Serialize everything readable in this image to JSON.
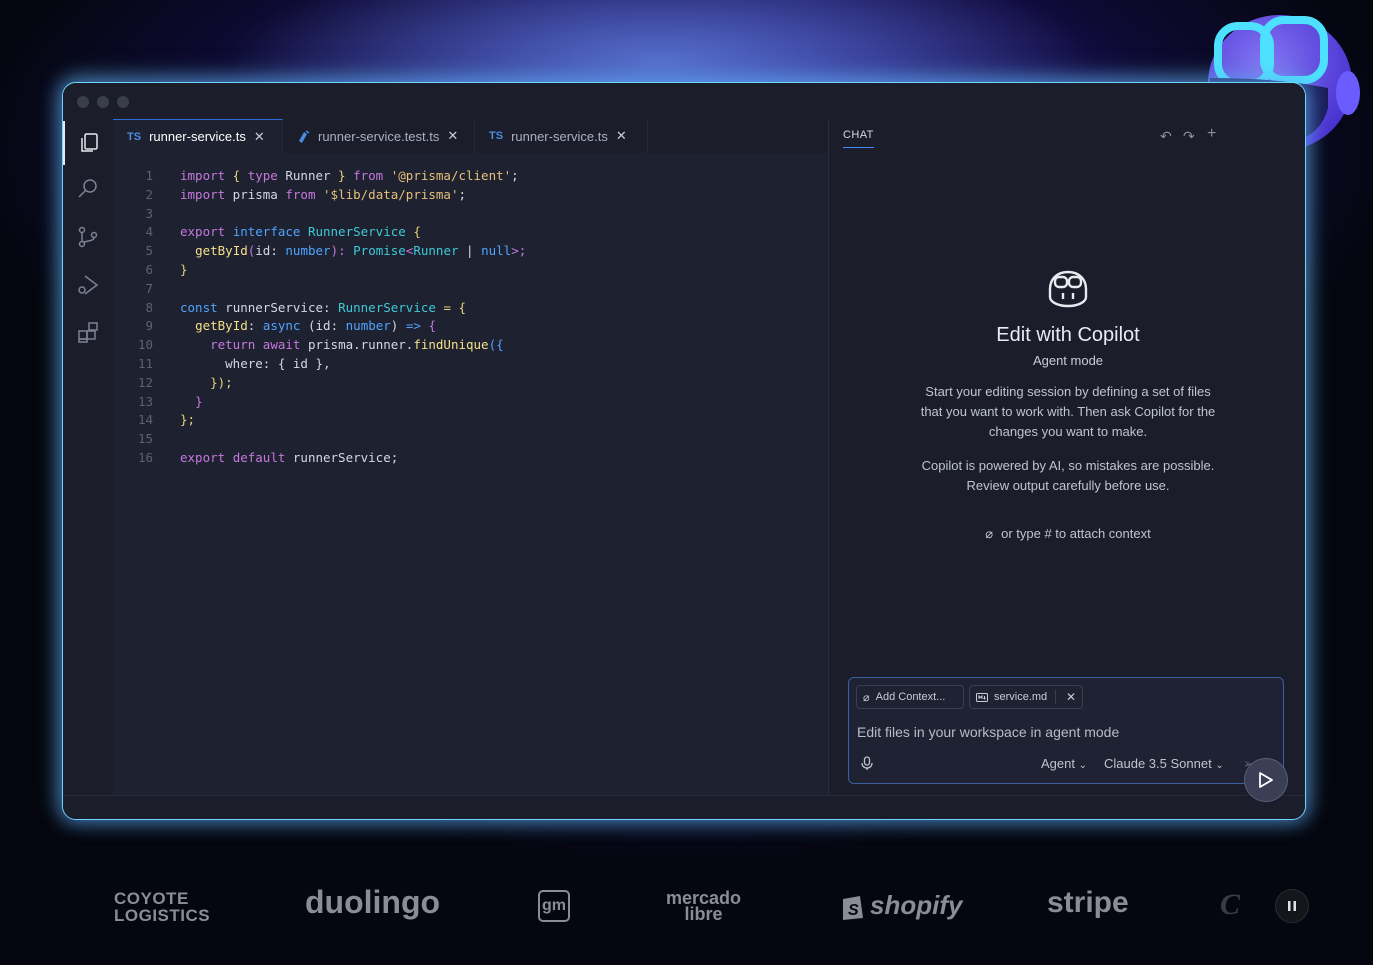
{
  "editor": {
    "tabs": [
      {
        "badge": "TS",
        "label": "runner-service.ts",
        "active": true
      },
      {
        "badge": "",
        "label": "runner-service.test.ts",
        "active": false
      },
      {
        "badge": "TS",
        "label": "runner-service.ts",
        "active": false
      }
    ],
    "line_numbers": [
      "1",
      "2",
      "3",
      "4",
      "5",
      "6",
      "7",
      "8",
      "9",
      "10",
      "11",
      "12",
      "13",
      "14",
      "15",
      "16"
    ],
    "code": {
      "l1": [
        "import",
        " { ",
        "type",
        " ",
        "Runner",
        " } ",
        "from",
        " ",
        "'@prisma/client'",
        ";"
      ],
      "l2": [
        "import",
        " prisma ",
        "from",
        " ",
        "'$lib/data/prisma'",
        ";"
      ],
      "l4": [
        "export",
        " ",
        "interface",
        " ",
        "RunnerService",
        " {"
      ],
      "l5": [
        "getById",
        "(",
        "id",
        ": ",
        "number",
        "): ",
        "Promise",
        "<",
        "Runner",
        " | ",
        "null",
        ">;"
      ],
      "l6": [
        "}"
      ],
      "l8": [
        "const",
        " ",
        "runnerService",
        ": ",
        "RunnerService",
        " = {"
      ],
      "l9": [
        "getById",
        ": ",
        "async",
        " (",
        "id",
        ": ",
        "number",
        ") ",
        "=>",
        " {"
      ],
      "l10": [
        "return",
        " ",
        "await",
        " prisma.runner.",
        "findUnique",
        "({"
      ],
      "l11": [
        "where: { id },"
      ],
      "l12": [
        "});"
      ],
      "l13": [
        "}"
      ],
      "l14": [
        "};"
      ],
      "l16": [
        "export",
        " ",
        "default",
        " runnerService;"
      ]
    }
  },
  "chat": {
    "tab_label": "CHAT",
    "title": "Edit with Copilot",
    "subtitle": "Agent mode",
    "paragraph1": "Start your editing session by defining a set of files that you want to work with. Then ask Copilot for the changes you want to make.",
    "paragraph2": "Copilot is powered by AI, so mistakes are possible. Review output carefully before use.",
    "attach_hint": "or type # to attach context",
    "input": {
      "add_context_label": "Add Context...",
      "file_chip_label": "service.md",
      "placeholder": "Edit files in your workspace in agent mode",
      "mode_label": "Agent",
      "model_label": "Claude 3.5 Sonnet"
    }
  },
  "logos": {
    "coyote_line1": "COYOTE",
    "coyote_line2": "LOGISTICS",
    "duolingo": "duolingo",
    "gm": "gm",
    "mercado_line1": "mercado",
    "mercado_line2": "libre",
    "shopify": "shopify",
    "stripe": "stripe"
  },
  "colors": {
    "accent": "#3d8bff",
    "window_border": "#6fd6ff",
    "keyword": "#c678dd",
    "type": "#3ec9d6",
    "string": "#e6c07b"
  }
}
